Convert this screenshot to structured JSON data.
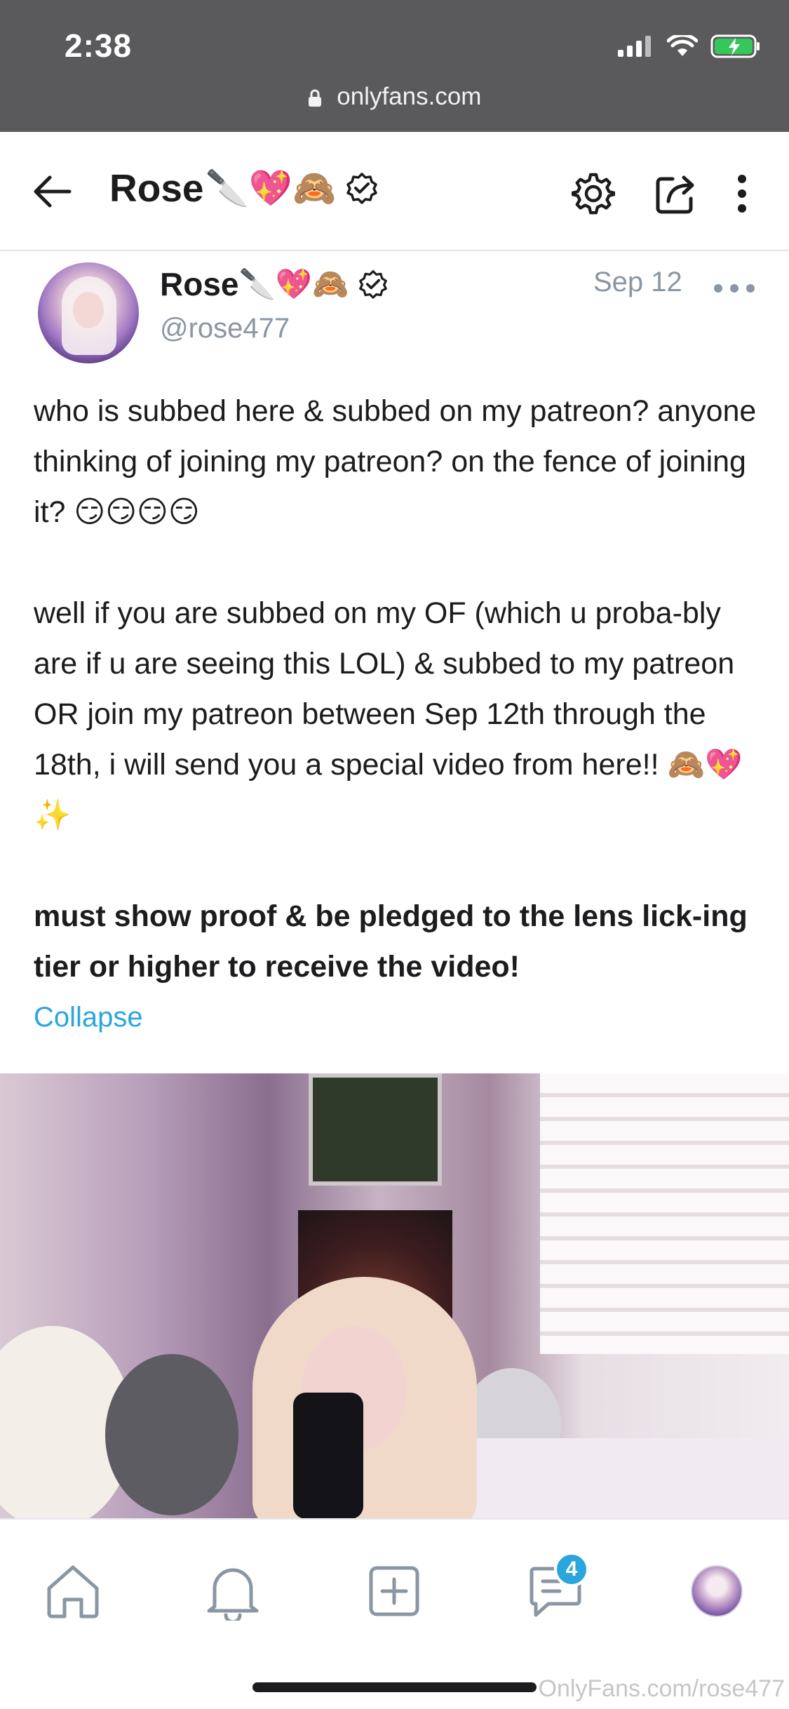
{
  "status_bar": {
    "time": "2:38",
    "url": "onlyfans.com"
  },
  "header": {
    "title": "Rose",
    "title_emojis": "🔪💖🙈"
  },
  "post": {
    "author_name": "Rose",
    "author_emojis": "🔪💖🙈",
    "handle": "@rose477",
    "date": "Sep 12",
    "paragraphs": {
      "p1": "who is subbed here & subbed on my patreon? anyone thinking of joining my patreon? on the fence of joining it? 😏😏😏😏",
      "p2": "well if you are subbed on my OF (which u proba-bly are if u are seeing this LOL) & subbed to my patreon OR join my patreon between Sep 12th through the 18th, i will send you a special video from here!! 🙈💖✨",
      "p3": "must show proof & be pledged to the lens lick-ing tier or higher to receive the video!"
    },
    "collapse_label": "Collapse"
  },
  "bottom_nav": {
    "messages_badge": "4"
  },
  "watermark": "OnlyFans.com/rose477",
  "colors": {
    "accent": "#2aa6dd",
    "muted": "#8a96a3",
    "browser_bar": "#5a5a5c"
  }
}
